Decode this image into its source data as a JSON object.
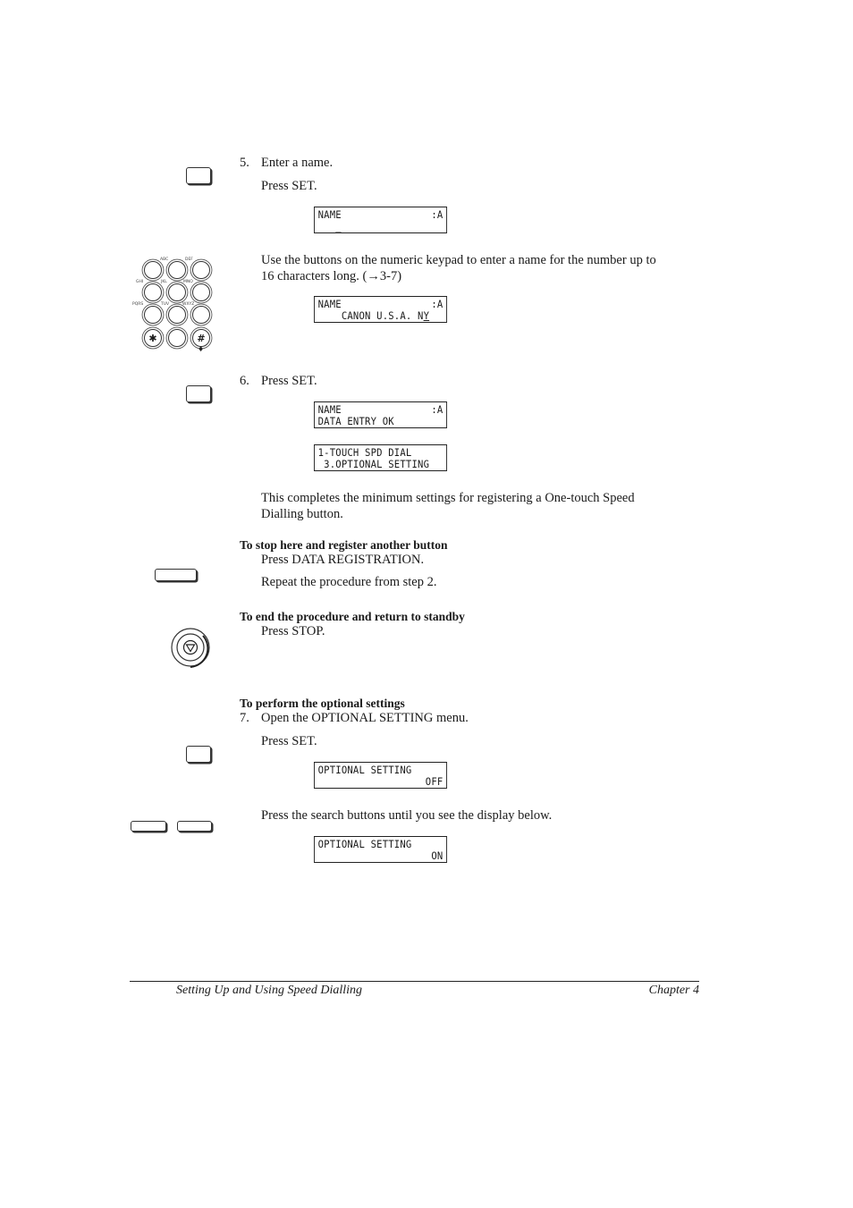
{
  "step5": {
    "number": "5.",
    "title": "Enter a name.",
    "press": "Press SET.",
    "lcd1": {
      "line1_left": "NAME",
      "line1_right": ":A",
      "line2": "   _"
    },
    "keypad_instruction": "Use the buttons on the numeric keypad to enter a name for the number up to",
    "keypad_instruction_2": "16 characters long. (→3-7)",
    "lcd2": {
      "line1_left": "NAME",
      "line1_right": ":A",
      "line2_prefix": "    CANON U.S.A. N",
      "line2_cursor": "Y"
    }
  },
  "keypad": {
    "labels": [
      "ABC",
      "DEF",
      "GHI",
      "JKL",
      "MNO",
      "PQRS",
      "TUV",
      "WXYZ"
    ],
    "star": "✱",
    "hash": "#",
    "tone": "♦"
  },
  "step6": {
    "number": "6.",
    "press": "Press SET.",
    "lcd1": {
      "line1_left": "NAME",
      "line1_right": ":A",
      "line2": "DATA ENTRY OK"
    },
    "lcd2": {
      "line1": "1-TOUCH SPD DIAL",
      "line2": " 3.OPTIONAL SETTING"
    },
    "completion": "This completes the minimum settings for registering a One-touch Speed",
    "completion_2": "Dialling button."
  },
  "stop_here": {
    "heading": "To stop here and register another button",
    "press": "Press DATA REGISTRATION.",
    "repeat": "Repeat the procedure from step 2."
  },
  "end_procedure": {
    "heading": "To end the procedure and return to standby",
    "press": "Press STOP."
  },
  "optional": {
    "heading": "To perform the optional settings",
    "number": "7.",
    "title": "Open the OPTIONAL SETTING menu.",
    "press": "Press SET.",
    "lcd1": {
      "line1": "OPTIONAL SETTING",
      "line2": "OFF"
    },
    "search": "Press the search buttons until you see the display below.",
    "lcd2": {
      "line1": "OPTIONAL SETTING",
      "line2": "ON"
    }
  },
  "footer": {
    "left": "Setting Up and Using Speed Dialling",
    "right": "Chapter 4"
  }
}
